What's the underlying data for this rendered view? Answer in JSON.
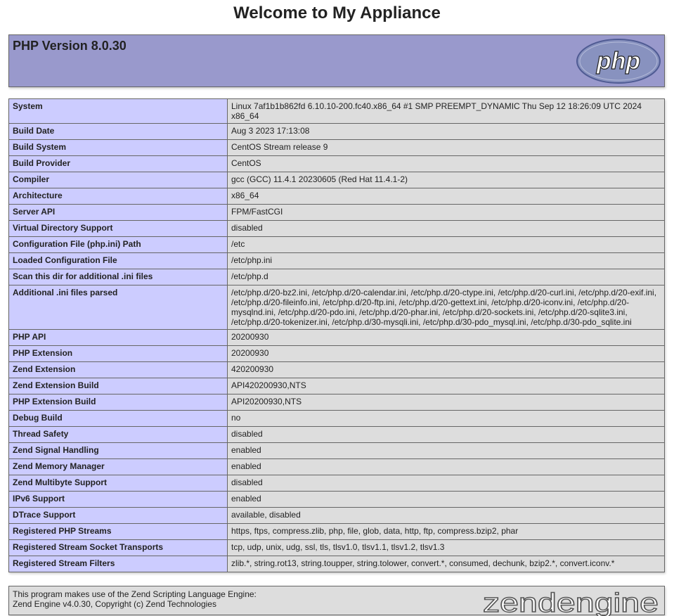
{
  "page": {
    "title": "Welcome to My Appliance"
  },
  "header": {
    "version_title": "PHP Version 8.0.30",
    "logo_text": "php",
    "logo_colors": {
      "fill": "#8892bf",
      "outline": "#4f5b93",
      "text": "#ffffff"
    }
  },
  "info_rows": [
    {
      "label": "System",
      "value": "Linux 7af1b1b862fd 6.10.10-200.fc40.x86_64 #1 SMP PREEMPT_DYNAMIC Thu Sep 12 18:26:09 UTC 2024 x86_64"
    },
    {
      "label": "Build Date",
      "value": "Aug 3 2023 17:13:08"
    },
    {
      "label": "Build System",
      "value": "CentOS Stream release 9"
    },
    {
      "label": "Build Provider",
      "value": "CentOS"
    },
    {
      "label": "Compiler",
      "value": "gcc (GCC) 11.4.1 20230605 (Red Hat 11.4.1-2)"
    },
    {
      "label": "Architecture",
      "value": "x86_64"
    },
    {
      "label": "Server API",
      "value": "FPM/FastCGI"
    },
    {
      "label": "Virtual Directory Support",
      "value": "disabled"
    },
    {
      "label": "Configuration File (php.ini) Path",
      "value": "/etc"
    },
    {
      "label": "Loaded Configuration File",
      "value": "/etc/php.ini"
    },
    {
      "label": "Scan this dir for additional .ini files",
      "value": "/etc/php.d"
    },
    {
      "label": "Additional .ini files parsed",
      "value": "/etc/php.d/20-bz2.ini, /etc/php.d/20-calendar.ini, /etc/php.d/20-ctype.ini, /etc/php.d/20-curl.ini, /etc/php.d/20-exif.ini, /etc/php.d/20-fileinfo.ini, /etc/php.d/20-ftp.ini, /etc/php.d/20-gettext.ini, /etc/php.d/20-iconv.ini, /etc/php.d/20-mysqlnd.ini, /etc/php.d/20-pdo.ini, /etc/php.d/20-phar.ini, /etc/php.d/20-sockets.ini, /etc/php.d/20-sqlite3.ini, /etc/php.d/20-tokenizer.ini, /etc/php.d/30-mysqli.ini, /etc/php.d/30-pdo_mysql.ini, /etc/php.d/30-pdo_sqlite.ini"
    },
    {
      "label": "PHP API",
      "value": "20200930"
    },
    {
      "label": "PHP Extension",
      "value": "20200930"
    },
    {
      "label": "Zend Extension",
      "value": "420200930"
    },
    {
      "label": "Zend Extension Build",
      "value": "API420200930,NTS"
    },
    {
      "label": "PHP Extension Build",
      "value": "API20200930,NTS"
    },
    {
      "label": "Debug Build",
      "value": "no"
    },
    {
      "label": "Thread Safety",
      "value": "disabled"
    },
    {
      "label": "Zend Signal Handling",
      "value": "enabled"
    },
    {
      "label": "Zend Memory Manager",
      "value": "enabled"
    },
    {
      "label": "Zend Multibyte Support",
      "value": "disabled"
    },
    {
      "label": "IPv6 Support",
      "value": "enabled"
    },
    {
      "label": "DTrace Support",
      "value": "available, disabled"
    },
    {
      "label": "Registered PHP Streams",
      "value": "https, ftps, compress.zlib, php, file, glob, data, http, ftp, compress.bzip2, phar"
    },
    {
      "label": "Registered Stream Socket Transports",
      "value": "tcp, udp, unix, udg, ssl, tls, tlsv1.0, tlsv1.1, tlsv1.2, tlsv1.3"
    },
    {
      "label": "Registered Stream Filters",
      "value": "zlib.*, string.rot13, string.toupper, string.tolower, convert.*, consumed, dechunk, bzip2.*, convert.iconv.*"
    }
  ],
  "footer": {
    "line1": "This program makes use of the Zend Scripting Language Engine:",
    "line2": "Zend Engine v4.0.30, Copyright (c) Zend Technologies",
    "logo_text": "zendengine",
    "logo_color": "#555555"
  },
  "colors": {
    "header_bg": "#9999cc",
    "label_bg": "#ccccff",
    "value_bg": "#dddddd",
    "border": "#666666"
  }
}
